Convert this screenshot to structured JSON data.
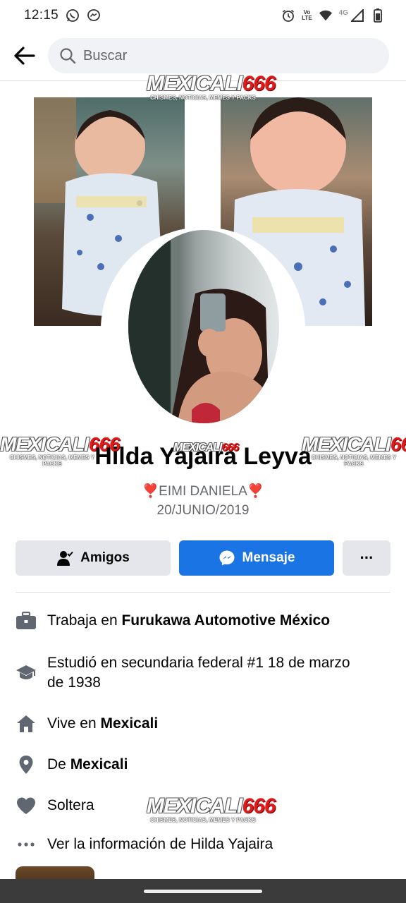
{
  "status_bar": {
    "time": "12:15",
    "left_icons": [
      "whatsapp-icon",
      "messenger-icon"
    ],
    "right_icons": [
      "alarm-icon",
      "volte-icon",
      "wifi-icon",
      "signal-icon",
      "battery-icon"
    ],
    "volte_label_top": "Vo",
    "volte_label_bottom": "LTE",
    "network_label": "4G"
  },
  "header": {
    "search_placeholder": "Buscar"
  },
  "profile": {
    "name": "Hilda Yajaira Leyva",
    "bio_line_1": "❣️EIMI DANIELA❣️",
    "bio_line_2": "20/JUNIO/2019"
  },
  "actions": {
    "friends_label": "Amigos",
    "message_label": "Mensaje",
    "more_label": "···"
  },
  "intro": {
    "work_prefix": "Trabaja en ",
    "work_place": "Furukawa Automotive México",
    "education": "Estudió en secundaria federal #1 18 de marzo de 1938",
    "lives_prefix": "Vive en ",
    "lives_city": "Mexicali",
    "from_prefix": "De ",
    "from_city": "Mexicali",
    "relationship": "Soltera",
    "see_info": "Ver la información de Hilda Yajaira"
  },
  "watermark": {
    "brand_text": "MEXICALI",
    "brand_number": "666",
    "tagline": "CHISMES, NOTICIAS, MEMES Y PACKS"
  },
  "colors": {
    "messenger_blue": "#1b74e4",
    "button_gray": "#e4e6eb",
    "secondary_text": "#65676b",
    "icon_gray": "#606770"
  }
}
